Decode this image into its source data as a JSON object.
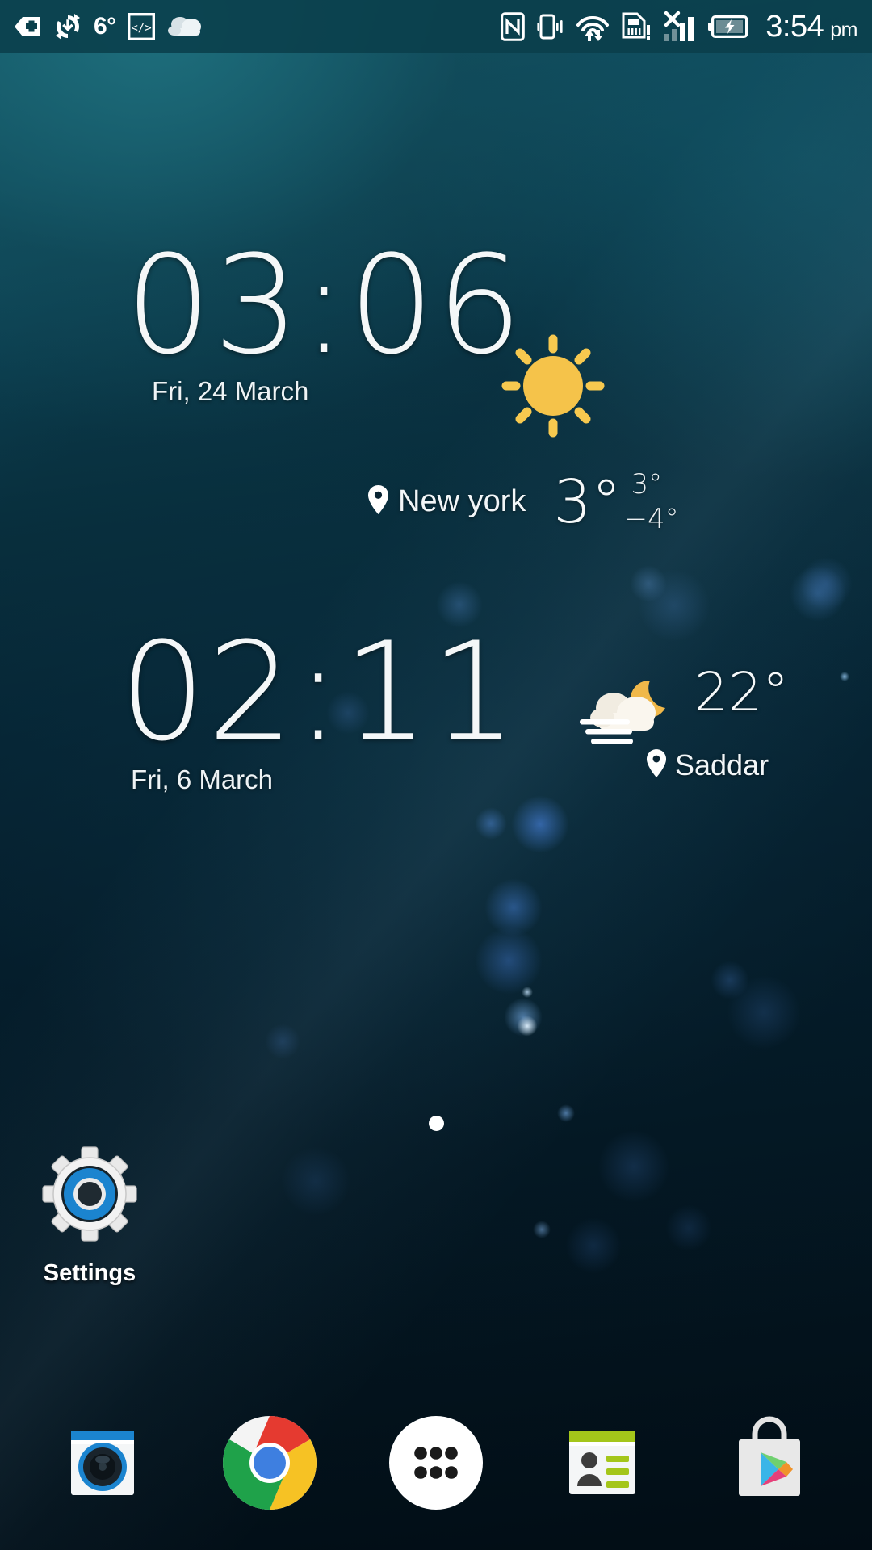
{
  "status_bar": {
    "left_icons": [
      {
        "name": "back-plus-icon",
        "label": "App install"
      },
      {
        "name": "sync-download-icon",
        "label": "Sync download"
      },
      {
        "name": "developer-brackets-icon",
        "label": "Developer options"
      },
      {
        "name": "cloud-icon",
        "label": "Cloud backup"
      }
    ],
    "temperature": "6°",
    "right_icons": [
      {
        "name": "nfc-icon",
        "label": "NFC"
      },
      {
        "name": "vibrate-icon",
        "label": "Vibrate"
      },
      {
        "name": "wifi-transfer-icon",
        "label": "Wi-Fi data transfer"
      },
      {
        "name": "sim-alert-icon",
        "label": "SIM card alert"
      },
      {
        "name": "no-signal-icon",
        "label": "No signal"
      },
      {
        "name": "battery-charging-icon",
        "label": "Battery charging"
      }
    ],
    "clock": "3:54",
    "clock_period": "pm"
  },
  "widget_primary": {
    "time": "03:06",
    "date": "Fri, 24 March",
    "weather_icon": "sun-icon",
    "location": "New york",
    "location_icon": "location-pin-icon",
    "temperature": "3°",
    "high": "3°",
    "low": "−4°"
  },
  "widget_secondary": {
    "time": "02:11",
    "date": "Fri, 6 March",
    "weather_icon": "night-fog-icon",
    "temperature": "22°",
    "location": "Saddar",
    "location_icon": "location-pin-icon"
  },
  "shortcuts": [
    {
      "name": "settings",
      "label": "Settings",
      "icon": "gear-icon"
    }
  ],
  "page_indicator": {
    "pages": 1,
    "current": 0
  },
  "dock": {
    "items": [
      {
        "name": "camera",
        "label": "Camera",
        "icon": "camera-icon"
      },
      {
        "name": "chrome",
        "label": "Chrome",
        "icon": "chrome-icon"
      },
      {
        "name": "app-drawer",
        "label": "Apps",
        "icon": "app-drawer-icon"
      },
      {
        "name": "contacts",
        "label": "Contacts",
        "icon": "contacts-icon"
      },
      {
        "name": "play-store",
        "label": "Play Store",
        "icon": "play-store-icon"
      }
    ]
  },
  "colors": {
    "status_bar_bg": "#0a3f4b",
    "wallpaper_top": "#176c7c",
    "wallpaper_bottom": "#020d15",
    "sun_yellow": "#f5c84c",
    "settings_blue": "#1b84cf",
    "accent_white": "#ffffff"
  }
}
